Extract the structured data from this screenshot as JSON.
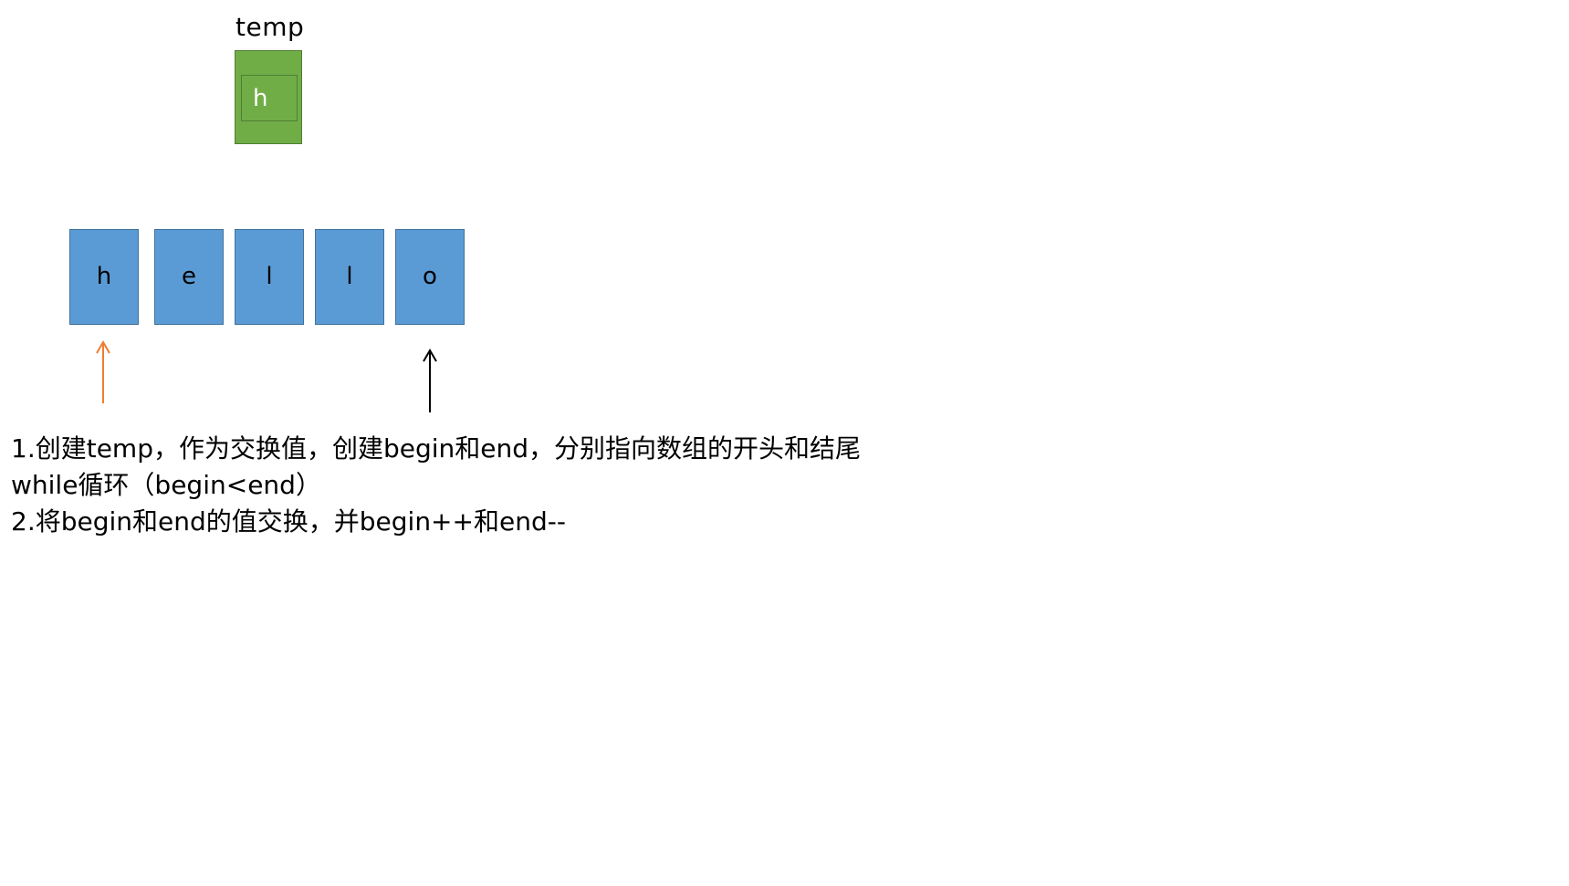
{
  "temp": {
    "label": "temp",
    "value": "h"
  },
  "array": {
    "cells": [
      "h",
      "e",
      "l",
      "l",
      "o"
    ]
  },
  "pointers": {
    "begin_color": "#ed7d31",
    "end_color": "#000000"
  },
  "colors": {
    "temp_fill": "#70ad47",
    "cell_fill": "#5b9bd5"
  },
  "notes": [
    "1.创建temp，作为交换值，创建begin和end，分别指向数组的开头和结尾",
    "while循环（begin<end）",
    "2.将begin和end的值交换，并begin++和end--"
  ]
}
